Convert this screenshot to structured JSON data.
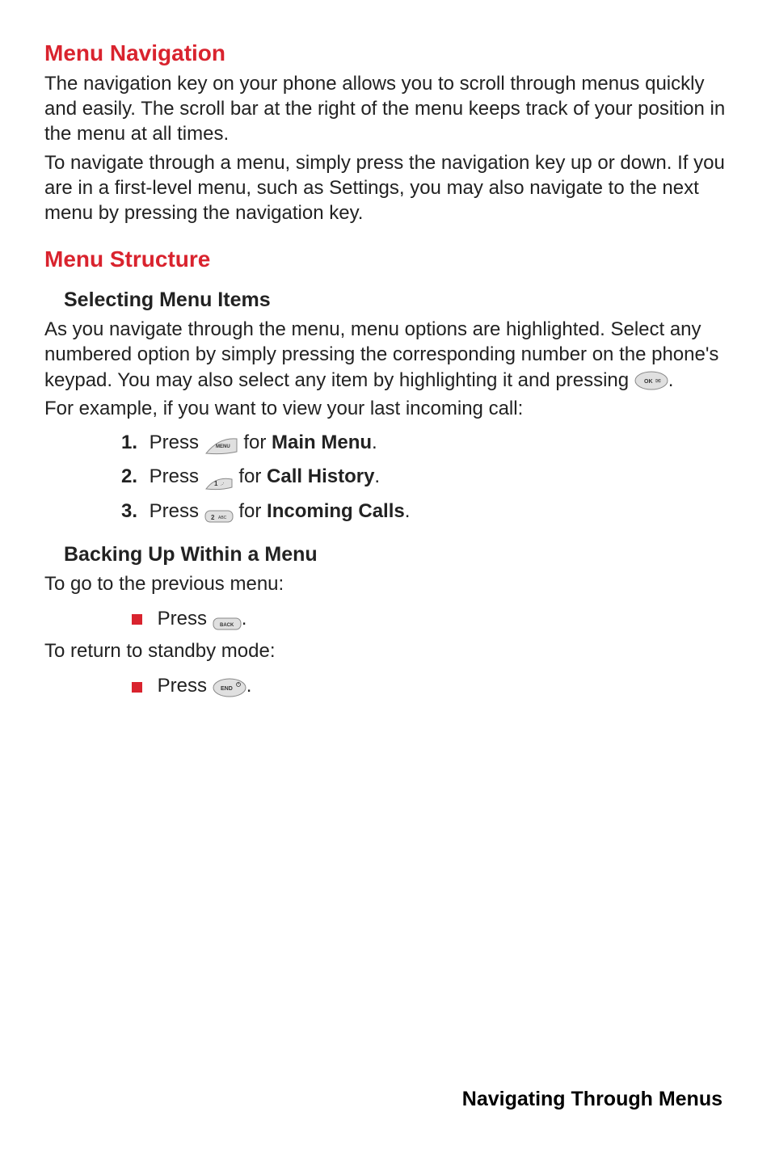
{
  "h1_nav": "Menu Navigation",
  "p_nav1": "The navigation key on your phone allows you to scroll through menus quickly and easily. The scroll bar at the right of the menu keeps track of your position in the menu at all times.",
  "p_nav2": "To navigate through a menu, simply press the navigation key up or down. If you are in a first-level menu, such as Settings, you may also navigate to the next menu by pressing the navigation key.",
  "h1_struct": "Menu Structure",
  "h2_select": "Selecting Menu Items",
  "p_select": "As you navigate through the menu, menu options are highlighted. Select any numbered option by simply pressing the corresponding number on the phone's keypad. You may also select any item by highlighting it and pressing ",
  "p_example": "For example, if you want to view your last incoming call:",
  "ol": [
    {
      "num": "1.",
      "pre": "Press ",
      "post1": " for ",
      "bold": "Main Menu",
      "post2": "."
    },
    {
      "num": "2.",
      "pre": "Press ",
      "post1": " for ",
      "bold": "Call History",
      "post2": "."
    },
    {
      "num": "3.",
      "pre": "Press ",
      "post1": " for ",
      "bold": "Incoming Calls",
      "post2": "."
    }
  ],
  "h2_back": "Backing Up Within a Menu",
  "p_back1": "To go to the previous menu:",
  "ul1_pre": "Press ",
  "p_back2": "To return to standby mode:",
  "ul2_pre": "Press ",
  "footer": "Navigating Through Menus",
  "keys": {
    "ok": "OK",
    "menu": "MENU",
    "one": "1",
    "two": "2 ABC",
    "back": "BACK",
    "end": "END"
  }
}
